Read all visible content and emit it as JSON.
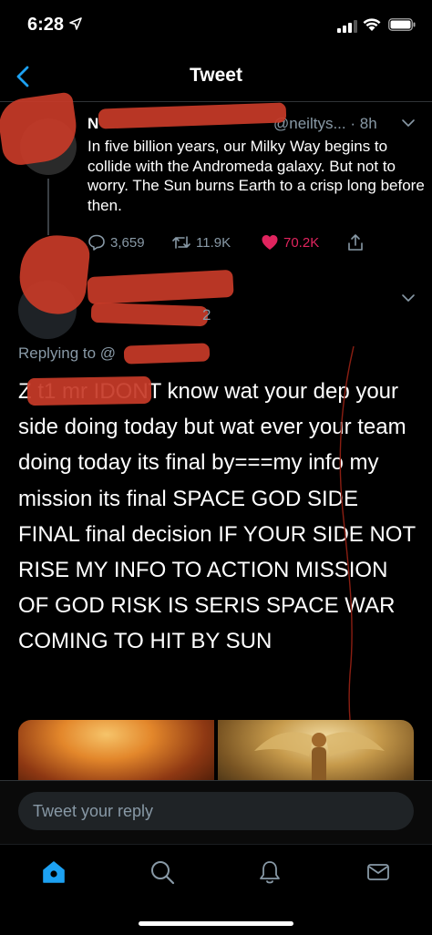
{
  "status_bar": {
    "time": "6:28"
  },
  "header": {
    "title": "Tweet"
  },
  "tweet1": {
    "name": "N",
    "handle": "@neiltys...",
    "time": "8h",
    "text": "In five billion years, our Milky Way begins to collide with the Andromeda galaxy. But not to worry. The Sun burns Earth to a crisp long before then.",
    "replies": "3,659",
    "retweets": "11.9K",
    "likes": "70.2K"
  },
  "tweet2": {
    "handle_suffix": "2",
    "replying_to": "Replying to @",
    "text": "Z                   t1 mr IDONT know wat your dep your side doing today but wat ever your team doing today its final by===my info my mission its final SPACE GOD SIDE FINAL final decision IF YOUR SIDE NOT RISE MY INFO TO ACTION MISSION OF GOD RISK IS SERIS SPACE WAR COMING TO HIT BY SUN"
  },
  "reply_bar": {
    "placeholder": "Tweet your reply"
  },
  "colors": {
    "accent": "#1da1f2",
    "like": "#e0245e",
    "muted": "#8899a6",
    "redaction": "#c63a28"
  },
  "icons": [
    "back-icon",
    "reply-icon",
    "retweet-icon",
    "heart-icon",
    "share-icon",
    "home-icon",
    "search-icon",
    "notifications-icon",
    "messages-icon"
  ]
}
